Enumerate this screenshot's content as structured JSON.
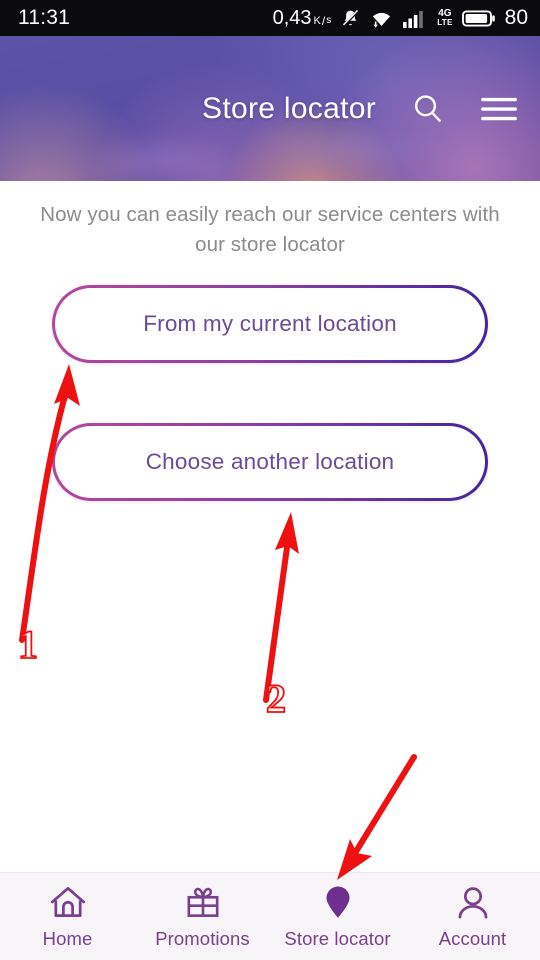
{
  "statusbar": {
    "time": "11:31",
    "net_speed_value": "0,43",
    "net_speed_unit_k": "K",
    "net_speed_unit_slash": "/",
    "net_speed_unit_s": "s",
    "mute_icon": "bell-muted-icon",
    "wifi_icon": "wifi-download-icon",
    "signal_icon": "cellular-signal-icon",
    "network_type_line1": "4G",
    "network_type_line2": "LTE",
    "battery_icon": "battery-icon",
    "battery_percent": "80"
  },
  "header": {
    "title": "Store locator",
    "search_icon": "search-icon",
    "menu_icon": "hamburger-menu-icon",
    "title_color": "#ffffff",
    "bg_color": "#5d52a6"
  },
  "main": {
    "subtitle": "Now you can easily reach our service centers with our store locator",
    "subtitle_color": "#8b8b90",
    "buttons": [
      {
        "label": "From my current location",
        "text_color": "#6d4a97"
      },
      {
        "label": "Choose another location",
        "text_color": "#6d4a97"
      }
    ],
    "gradient_start": "#b4479c",
    "gradient_end": "#45239c"
  },
  "annotations": {
    "color": "#ee1111",
    "markers": [
      {
        "label": "1",
        "target": "From my current location"
      },
      {
        "label": "2",
        "target": "Choose another location"
      },
      {
        "label": "",
        "target": "Store locator"
      }
    ]
  },
  "bottom_nav": {
    "active_color": "#6f2f8e",
    "label_color": "#7a3f8d",
    "items": [
      {
        "label": "Home",
        "icon": "home-icon",
        "active": false
      },
      {
        "label": "Promotions",
        "icon": "gift-icon",
        "active": false
      },
      {
        "label": "Store locator",
        "icon": "map-pin-icon",
        "active": true
      },
      {
        "label": "Account",
        "icon": "person-icon",
        "active": false
      }
    ]
  }
}
